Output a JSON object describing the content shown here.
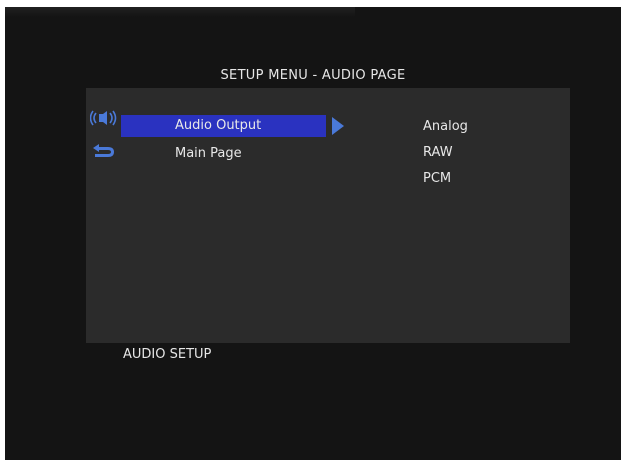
{
  "menu": {
    "title": "SETUP MENU - AUDIO PAGE",
    "items": [
      {
        "label": "Audio Output",
        "icon": "speaker-icon",
        "selected": true
      },
      {
        "label": "Main Page",
        "icon": "return-icon",
        "selected": false
      }
    ],
    "options": [
      "Analog",
      "RAW",
      "PCM"
    ]
  },
  "status": {
    "text": "AUDIO SETUP"
  },
  "colors": {
    "background": "#141414",
    "panel": "#2b2b2b",
    "highlight": "#2a32c0",
    "arrow": "#4a79d8",
    "text": "#e8e8e8"
  }
}
